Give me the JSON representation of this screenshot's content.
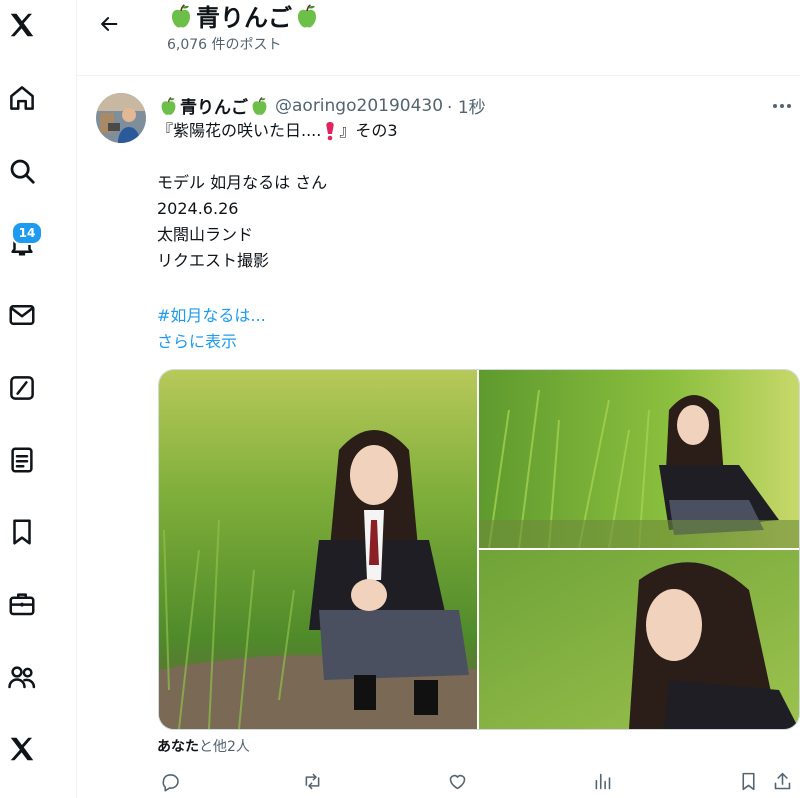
{
  "header": {
    "title": "青りんご",
    "post_count": "6,076 件のポスト"
  },
  "nav": {
    "notifications_badge": "14",
    "icons": [
      "x-logo-icon",
      "home-icon",
      "search-icon",
      "notifications-icon",
      "messages-icon",
      "grok-icon",
      "lists-icon",
      "bookmarks-icon",
      "jobs-icon",
      "communities-icon",
      "premium-x-icon"
    ]
  },
  "post": {
    "display_name": "青りんご",
    "handle": "@aoringo20190430",
    "time": "· 1秒",
    "lines": [
      "『紫陽花の咲いた日....",
      "』その3",
      "",
      "モデル 如月なるは さん",
      "2024.6.26",
      "太閤山ランド",
      "リクエスト撮影"
    ],
    "hashtag": "#如月なるは...",
    "show_more": "さらに表示",
    "liked_by_first": "あなた",
    "liked_by_rest": "と他2人"
  },
  "colors": {
    "accent": "#1d9bf0",
    "text": "#0f1419",
    "secondary_text": "#536471",
    "border": "#eff3f4",
    "apple_green": "#6cc04a"
  }
}
